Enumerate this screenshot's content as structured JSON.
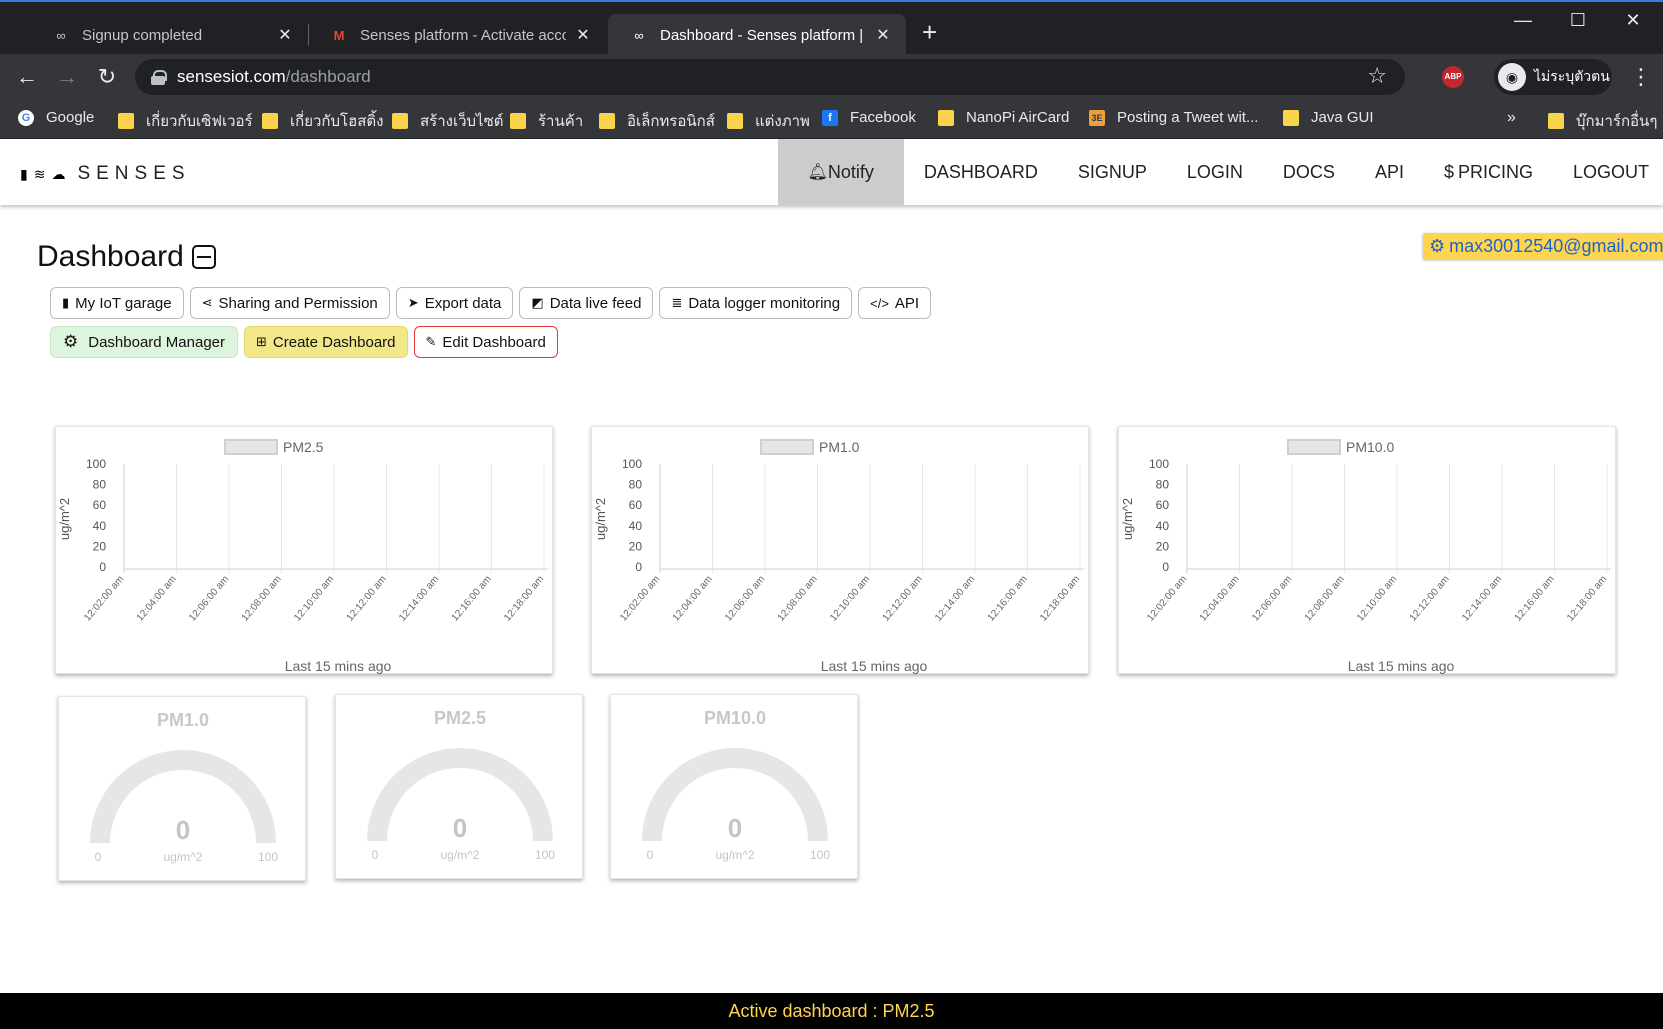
{
  "browser": {
    "tabs": [
      {
        "title": "Signup completed",
        "icon": "infinity-icon"
      },
      {
        "title": "Senses platform - Activate accou",
        "icon": "gmail-icon"
      },
      {
        "title": "Dashboard - Senses platform | In",
        "icon": "infinity-icon",
        "active": true
      }
    ],
    "url_domain": "sensesiot.com",
    "url_path": "/dashboard",
    "profile_label": "ไม่ระบุตัวตน",
    "abp_label": "ABP",
    "bookmarks": [
      {
        "label": "Google",
        "icon": "google-icon"
      },
      {
        "label": "เกี่ยวกับเซิฟเวอร์",
        "icon": "folder-icon"
      },
      {
        "label": "เกี่ยวกับโฮสติ้ง",
        "icon": "folder-icon"
      },
      {
        "label": "สร้างเว็บไซต์",
        "icon": "folder-icon"
      },
      {
        "label": "ร้านค้า",
        "icon": "folder-icon"
      },
      {
        "label": "อิเล็กทรอนิกส์",
        "icon": "folder-icon"
      },
      {
        "label": "แต่งภาพ",
        "icon": "folder-icon"
      },
      {
        "label": "Facebook",
        "icon": "facebook-icon"
      },
      {
        "label": "NanoPi AirCard",
        "icon": "folder-icon"
      },
      {
        "label": "Posting a Tweet wit...",
        "icon": "site-icon"
      },
      {
        "label": "Java GUI",
        "icon": "folder-icon"
      }
    ],
    "bookmarks_overflow": "»",
    "other_bookmarks": "บุ๊กมาร์กอื่นๆ"
  },
  "site": {
    "brand": "SENSES",
    "nav": [
      {
        "label": "Notify",
        "icon": "bell-icon",
        "active": true
      },
      {
        "label": "DASHBOARD"
      },
      {
        "label": "SIGNUP"
      },
      {
        "label": "LOGIN"
      },
      {
        "label": "DOCS"
      },
      {
        "label": "API"
      },
      {
        "label": "PRICING",
        "icon": "dollar-icon"
      },
      {
        "label": "LOGOUT"
      }
    ],
    "user_email": "max30012540@gmail.com",
    "page_title": "Dashboard",
    "toolbar_row1": [
      {
        "label": "My IoT garage",
        "icon": "device-icon"
      },
      {
        "label": "Sharing and Permission",
        "icon": "share-icon"
      },
      {
        "label": "Export data",
        "icon": "send-icon"
      },
      {
        "label": "Data live feed",
        "icon": "rss-icon"
      },
      {
        "label": "Data logger monitoring",
        "icon": "database-icon"
      },
      {
        "label": "API",
        "icon": "code-icon"
      }
    ],
    "toolbar_row2": [
      {
        "label": "Dashboard Manager",
        "icon": "gear-icon",
        "style": "green"
      },
      {
        "label": "Create Dashboard",
        "icon": "plus-square-icon",
        "style": "yellow"
      },
      {
        "label": "Edit Dashboard",
        "icon": "edit-icon",
        "style": "red"
      }
    ],
    "footer": "Active dashboard : PM2.5"
  },
  "chart_data": [
    {
      "type": "line",
      "legend": "PM2.5",
      "ylabel": "ug/m^2",
      "xlabel": "Last 15 mins ago",
      "ylim": [
        0,
        100
      ],
      "yticks": [
        0,
        20,
        40,
        60,
        80,
        100
      ],
      "categories": [
        "12:02:00 am",
        "12:04:00 am",
        "12:06:00 am",
        "12:08:00 am",
        "12:10:00 am",
        "12:12:00 am",
        "12:14:00 am",
        "12:16:00 am",
        "12:18:00 am"
      ],
      "series": [
        {
          "name": "PM2.5",
          "values": []
        }
      ],
      "grid": true
    },
    {
      "type": "line",
      "legend": "PM1.0",
      "ylabel": "ug/m^2",
      "xlabel": "Last 15 mins ago",
      "ylim": [
        0,
        100
      ],
      "yticks": [
        0,
        20,
        40,
        60,
        80,
        100
      ],
      "categories": [
        "12:02:00 am",
        "12:04:00 am",
        "12:06:00 am",
        "12:08:00 am",
        "12:10:00 am",
        "12:12:00 am",
        "12:14:00 am",
        "12:16:00 am",
        "12:18:00 am"
      ],
      "series": [
        {
          "name": "PM1.0",
          "values": []
        }
      ],
      "grid": true
    },
    {
      "type": "line",
      "legend": "PM10.0",
      "ylabel": "ug/m^2",
      "xlabel": "Last 15 mins ago",
      "ylim": [
        0,
        100
      ],
      "yticks": [
        0,
        20,
        40,
        60,
        80,
        100
      ],
      "categories": [
        "12:02:00 am",
        "12:04:00 am",
        "12:06:00 am",
        "12:08:00 am",
        "12:10:00 am",
        "12:12:00 am",
        "12:14:00 am",
        "12:16:00 am",
        "12:18:00 am"
      ],
      "series": [
        {
          "name": "PM10.0",
          "values": []
        }
      ],
      "grid": true
    }
  ],
  "gauges": [
    {
      "title": "PM1.0",
      "value": 0,
      "min": 0,
      "max": 100,
      "unit": "ug/m^2"
    },
    {
      "title": "PM2.5",
      "value": 0,
      "min": 0,
      "max": 100,
      "unit": "ug/m^2"
    },
    {
      "title": "PM10.0",
      "value": 0,
      "min": 0,
      "max": 100,
      "unit": "ug/m^2"
    }
  ]
}
